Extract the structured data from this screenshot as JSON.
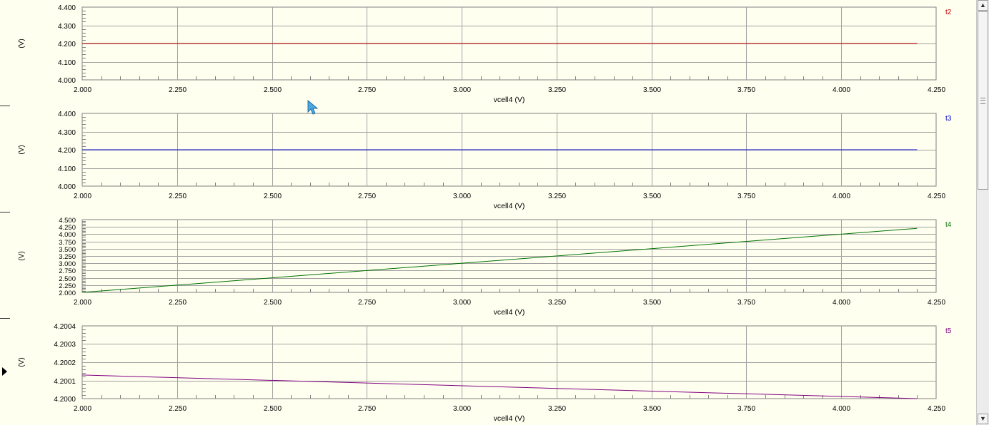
{
  "chart_data": [
    {
      "type": "line",
      "series": [
        {
          "name": "t2",
          "color": "#c00000",
          "x": [
            2.0,
            4.2
          ],
          "y": [
            4.2,
            4.2
          ]
        }
      ],
      "xlabel": "vcell4 (V)",
      "ylabel": "(V)",
      "xlim": [
        2.0,
        4.25
      ],
      "ylim": [
        4.0,
        4.4
      ],
      "xticks": [
        "2.000",
        "2.250",
        "2.500",
        "2.750",
        "3.000",
        "3.250",
        "3.500",
        "3.750",
        "4.000",
        "4.250"
      ],
      "yticks": [
        "4.000",
        "4.100",
        "4.200",
        "4.300",
        "4.400"
      ],
      "grid": true,
      "legend": "top-right"
    },
    {
      "type": "line",
      "series": [
        {
          "name": "t3",
          "color": "#0000cc",
          "x": [
            2.0,
            4.2
          ],
          "y": [
            4.2,
            4.2
          ]
        }
      ],
      "xlabel": "vcell4 (V)",
      "ylabel": "(V)",
      "xlim": [
        2.0,
        4.25
      ],
      "ylim": [
        4.0,
        4.4
      ],
      "xticks": [
        "2.000",
        "2.250",
        "2.500",
        "2.750",
        "3.000",
        "3.250",
        "3.500",
        "3.750",
        "4.000",
        "4.250"
      ],
      "yticks": [
        "4.000",
        "4.100",
        "4.200",
        "4.300",
        "4.400"
      ],
      "grid": true,
      "legend": "top-right"
    },
    {
      "type": "line",
      "series": [
        {
          "name": "t4",
          "color": "#007000",
          "x": [
            2.0,
            4.2
          ],
          "y": [
            2.0,
            4.2
          ]
        }
      ],
      "xlabel": "vcell4 (V)",
      "ylabel": "(V)",
      "xlim": [
        2.0,
        4.25
      ],
      "ylim": [
        2.0,
        4.5
      ],
      "xticks": [
        "2.000",
        "2.250",
        "2.500",
        "2.750",
        "3.000",
        "3.250",
        "3.500",
        "3.750",
        "4.000",
        "4.250"
      ],
      "yticks": [
        "2.000",
        "2.250",
        "2.500",
        "2.750",
        "3.000",
        "3.250",
        "3.500",
        "3.750",
        "4.000",
        "4.250",
        "4.500"
      ],
      "grid": true,
      "legend": "top-right"
    },
    {
      "type": "line",
      "series": [
        {
          "name": "t5",
          "color": "#800080",
          "x": [
            2.0,
            4.2
          ],
          "y": [
            4.20013,
            4.2
          ]
        }
      ],
      "xlabel": "vcell4 (V)",
      "ylabel": "(V)",
      "xlim": [
        2.0,
        4.25
      ],
      "ylim": [
        4.2,
        4.2004
      ],
      "xticks": [
        "2.000",
        "2.250",
        "2.500",
        "2.750",
        "3.000",
        "3.250",
        "3.500",
        "3.750",
        "4.000",
        "4.250"
      ],
      "yticks": [
        "4.2000",
        "4.2001",
        "4.2002",
        "4.2003",
        "4.2004"
      ],
      "grid": true,
      "legend": "top-right"
    }
  ]
}
